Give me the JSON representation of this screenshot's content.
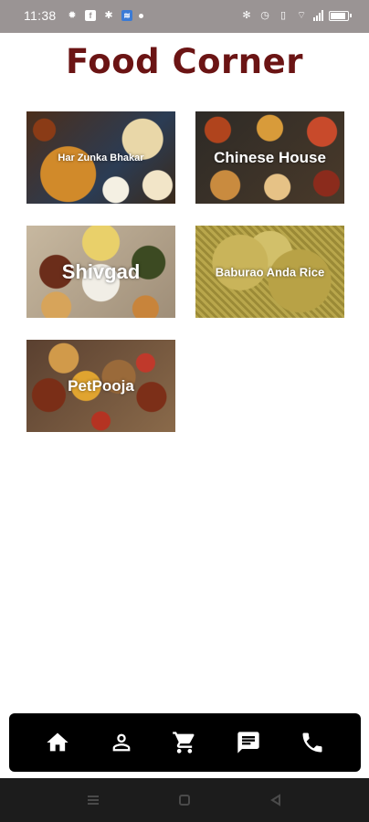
{
  "status_bar": {
    "time": "11:38",
    "icons_left": [
      "settings-icon",
      "facebook-icon",
      "messenger-icon",
      "app-icon",
      "dot-icon"
    ],
    "icons_right": [
      "bluetooth-icon",
      "alarm-icon",
      "vibrate-icon",
      "wifi-icon",
      "signal-icon",
      "battery-icon"
    ]
  },
  "app": {
    "title": "Food Corner",
    "title_color": "#6b1414"
  },
  "restaurants": [
    {
      "name": "Har Zunka Bhakar"
    },
    {
      "name": "Chinese House"
    },
    {
      "name": "Shivgad"
    },
    {
      "name": "Baburao Anda Rice"
    },
    {
      "name": "PetPooja"
    }
  ],
  "bottom_nav": {
    "items": [
      "home-icon",
      "profile-icon",
      "cart-icon",
      "chat-icon",
      "phone-icon"
    ]
  },
  "system_nav": {
    "items": [
      "menu-icon",
      "home-square-icon",
      "back-icon"
    ]
  }
}
